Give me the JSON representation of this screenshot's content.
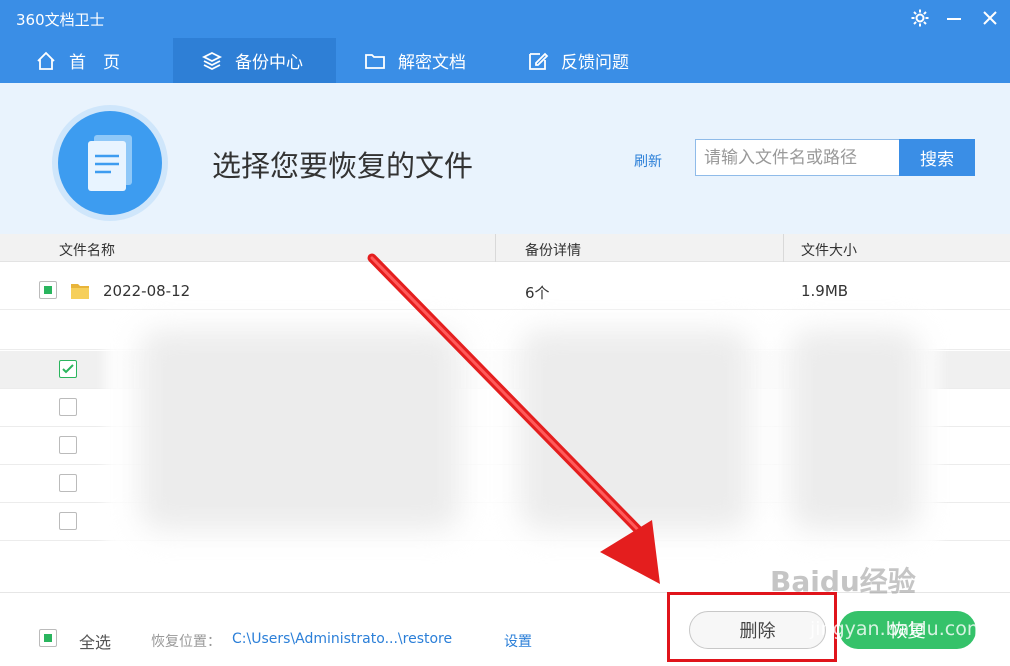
{
  "app": {
    "title": "360文档卫士"
  },
  "nav": {
    "tabs": [
      {
        "label": "首　页",
        "icon": "home-icon"
      },
      {
        "label": "备份中心",
        "icon": "layers-icon"
      },
      {
        "label": "解密文档",
        "icon": "folder-icon"
      },
      {
        "label": "反馈问题",
        "icon": "edit-icon"
      }
    ],
    "active_index": 1
  },
  "header": {
    "title": "选择您要恢复的文件",
    "refresh": "刷新",
    "search_placeholder": "请输入文件名或路径",
    "search_button": "搜索"
  },
  "table": {
    "columns": [
      "文件名称",
      "备份详情",
      "文件大小"
    ],
    "first_row": {
      "name": "2022-08-12",
      "detail": "6个",
      "size": "1.9MB"
    }
  },
  "footer": {
    "select_all": "全选",
    "restore_location_label": "恢复位置：",
    "restore_path": "C:\\Users\\Administrato...\\restore",
    "settings": "设置",
    "delete": "删除",
    "restore": "恢复"
  },
  "watermark": {
    "main": "Baidu经验",
    "sub": "jingyan.baidu.com"
  },
  "colors": {
    "primary": "#3a8ee6",
    "accent_green": "#35c26a",
    "highlight_red": "#e0141b"
  }
}
